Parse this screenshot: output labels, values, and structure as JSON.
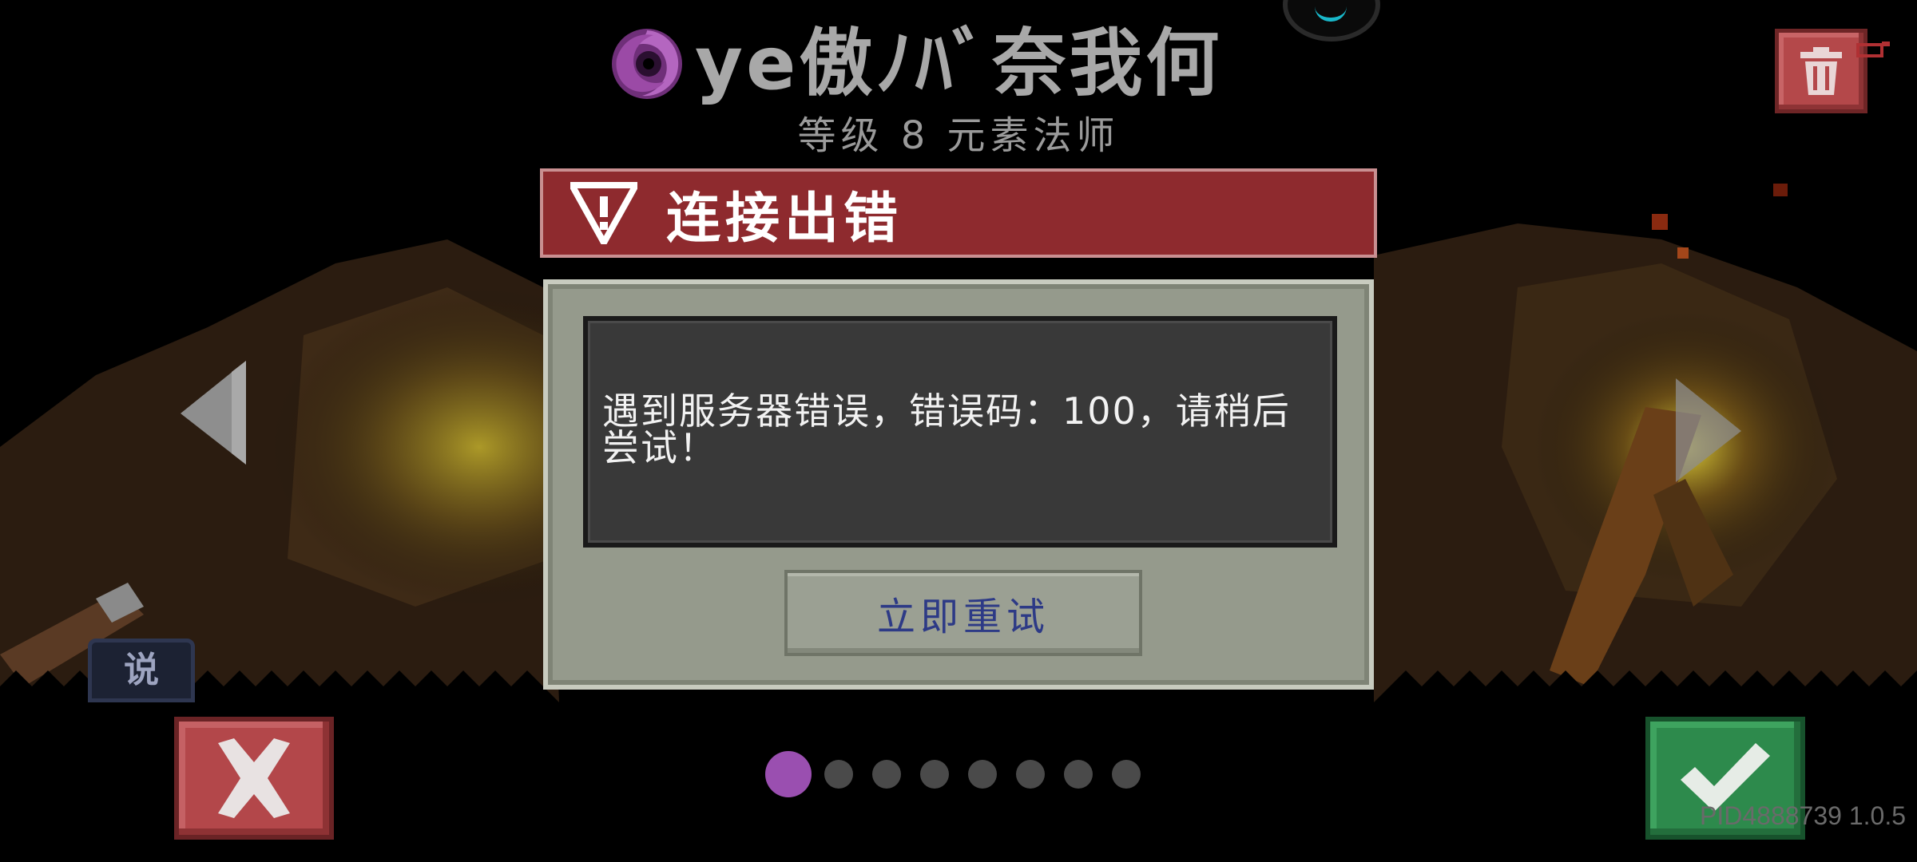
{
  "header": {
    "player_name": "ye傲ﾉﾊﾞ奈我何",
    "player_level": "等级 8 元素法师",
    "vortex_color": "#9b4aa6"
  },
  "dialog": {
    "title": "连接出错",
    "message": "遇到服务器错误，错误码：100，请稍后尝试！",
    "retry_label": "立即重试",
    "header_color": "#8e2a2e"
  },
  "left_tile": {
    "label": "说"
  },
  "pagination": {
    "total": 8,
    "active": 1,
    "active_color": "#9a4fb0"
  },
  "footer": {
    "build_info": "PID4888739 1.0.5"
  },
  "icons": {
    "delete": "trash-icon",
    "cancel": "x-icon",
    "confirm": "check-icon",
    "warning": "warning-triangle-icon",
    "prev": "arrow-left-icon",
    "next": "arrow-right-icon"
  },
  "colors": {
    "cancel": "#b3474a",
    "confirm": "#2d8a4c",
    "delete": "#b4484a",
    "panel": "#959a8c",
    "retry_text": "#2d3a86"
  }
}
